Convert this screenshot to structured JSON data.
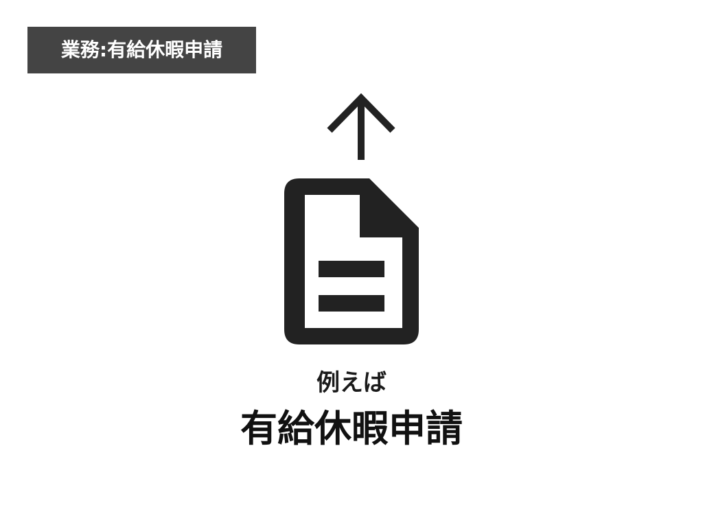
{
  "header": {
    "tag_label": "業務:有給休暇申請"
  },
  "icons": {
    "upload_arrow": "arrow-up-icon",
    "document": "document-icon"
  },
  "caption": {
    "lead": "例えば",
    "main": "有給休暇申請"
  },
  "colors": {
    "tag_background": "#444444",
    "tag_text": "#ffffff",
    "icon": "#222222",
    "text": "#111111"
  }
}
